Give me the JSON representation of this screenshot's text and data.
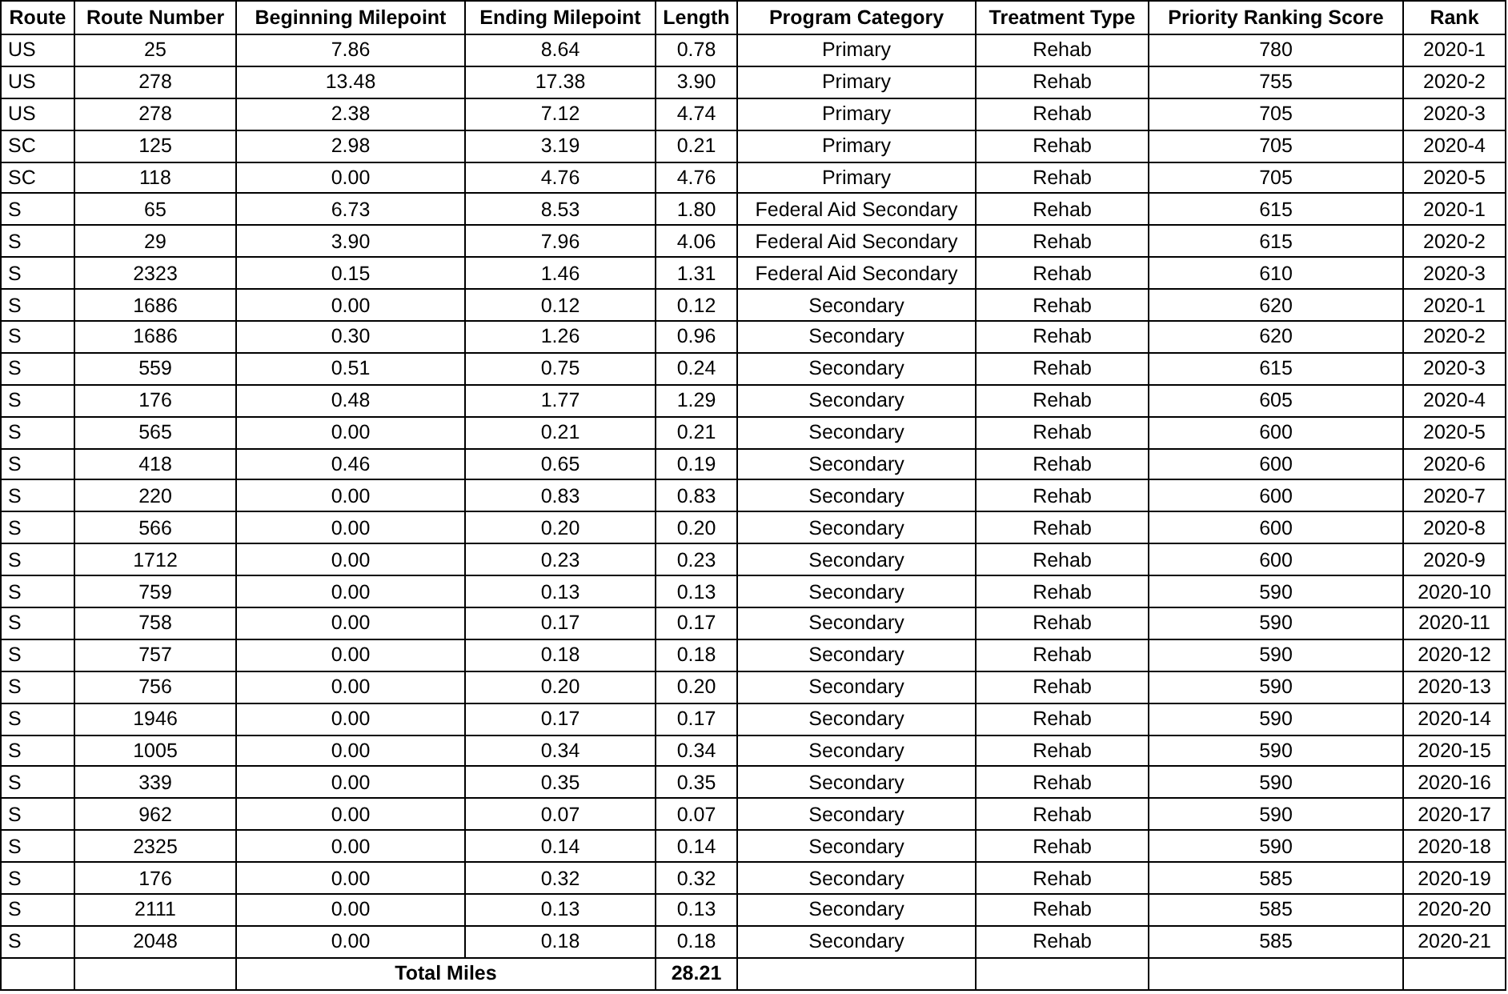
{
  "table": {
    "columns": [
      "Route",
      "Route Number",
      "Beginning Milepoint",
      "Ending Milepoint",
      "Length",
      "Program Category",
      "Treatment Type",
      "Priority Ranking Score",
      "Rank"
    ],
    "rows": [
      [
        "US",
        "25",
        "7.86",
        "8.64",
        "0.78",
        "Primary",
        "Rehab",
        "780",
        "2020-1"
      ],
      [
        "US",
        "278",
        "13.48",
        "17.38",
        "3.90",
        "Primary",
        "Rehab",
        "755",
        "2020-2"
      ],
      [
        "US",
        "278",
        "2.38",
        "7.12",
        "4.74",
        "Primary",
        "Rehab",
        "705",
        "2020-3"
      ],
      [
        "SC",
        "125",
        "2.98",
        "3.19",
        "0.21",
        "Primary",
        "Rehab",
        "705",
        "2020-4"
      ],
      [
        "SC",
        "118",
        "0.00",
        "4.76",
        "4.76",
        "Primary",
        "Rehab",
        "705",
        "2020-5"
      ],
      [
        "S",
        "65",
        "6.73",
        "8.53",
        "1.80",
        "Federal Aid Secondary",
        "Rehab",
        "615",
        "2020-1"
      ],
      [
        "S",
        "29",
        "3.90",
        "7.96",
        "4.06",
        "Federal Aid Secondary",
        "Rehab",
        "615",
        "2020-2"
      ],
      [
        "S",
        "2323",
        "0.15",
        "1.46",
        "1.31",
        "Federal Aid Secondary",
        "Rehab",
        "610",
        "2020-3"
      ],
      [
        "S",
        "1686",
        "0.00",
        "0.12",
        "0.12",
        "Secondary",
        "Rehab",
        "620",
        "2020-1"
      ],
      [
        "S",
        "1686",
        "0.30",
        "1.26",
        "0.96",
        "Secondary",
        "Rehab",
        "620",
        "2020-2"
      ],
      [
        "S",
        "559",
        "0.51",
        "0.75",
        "0.24",
        "Secondary",
        "Rehab",
        "615",
        "2020-3"
      ],
      [
        "S",
        "176",
        "0.48",
        "1.77",
        "1.29",
        "Secondary",
        "Rehab",
        "605",
        "2020-4"
      ],
      [
        "S",
        "565",
        "0.00",
        "0.21",
        "0.21",
        "Secondary",
        "Rehab",
        "600",
        "2020-5"
      ],
      [
        "S",
        "418",
        "0.46",
        "0.65",
        "0.19",
        "Secondary",
        "Rehab",
        "600",
        "2020-6"
      ],
      [
        "S",
        "220",
        "0.00",
        "0.83",
        "0.83",
        "Secondary",
        "Rehab",
        "600",
        "2020-7"
      ],
      [
        "S",
        "566",
        "0.00",
        "0.20",
        "0.20",
        "Secondary",
        "Rehab",
        "600",
        "2020-8"
      ],
      [
        "S",
        "1712",
        "0.00",
        "0.23",
        "0.23",
        "Secondary",
        "Rehab",
        "600",
        "2020-9"
      ],
      [
        "S",
        "759",
        "0.00",
        "0.13",
        "0.13",
        "Secondary",
        "Rehab",
        "590",
        "2020-10"
      ],
      [
        "S",
        "758",
        "0.00",
        "0.17",
        "0.17",
        "Secondary",
        "Rehab",
        "590",
        "2020-11"
      ],
      [
        "S",
        "757",
        "0.00",
        "0.18",
        "0.18",
        "Secondary",
        "Rehab",
        "590",
        "2020-12"
      ],
      [
        "S",
        "756",
        "0.00",
        "0.20",
        "0.20",
        "Secondary",
        "Rehab",
        "590",
        "2020-13"
      ],
      [
        "S",
        "1946",
        "0.00",
        "0.17",
        "0.17",
        "Secondary",
        "Rehab",
        "590",
        "2020-14"
      ],
      [
        "S",
        "1005",
        "0.00",
        "0.34",
        "0.34",
        "Secondary",
        "Rehab",
        "590",
        "2020-15"
      ],
      [
        "S",
        "339",
        "0.00",
        "0.35",
        "0.35",
        "Secondary",
        "Rehab",
        "590",
        "2020-16"
      ],
      [
        "S",
        "962",
        "0.00",
        "0.07",
        "0.07",
        "Secondary",
        "Rehab",
        "590",
        "2020-17"
      ],
      [
        "S",
        "2325",
        "0.00",
        "0.14",
        "0.14",
        "Secondary",
        "Rehab",
        "590",
        "2020-18"
      ],
      [
        "S",
        "176",
        "0.00",
        "0.32",
        "0.32",
        "Secondary",
        "Rehab",
        "585",
        "2020-19"
      ],
      [
        "S",
        "2111",
        "0.00",
        "0.13",
        "0.13",
        "Secondary",
        "Rehab",
        "585",
        "2020-20"
      ],
      [
        "S",
        "2048",
        "0.00",
        "0.18",
        "0.18",
        "Secondary",
        "Rehab",
        "585",
        "2020-21"
      ]
    ],
    "total": {
      "label": "Total Miles",
      "length": "28.21"
    }
  }
}
